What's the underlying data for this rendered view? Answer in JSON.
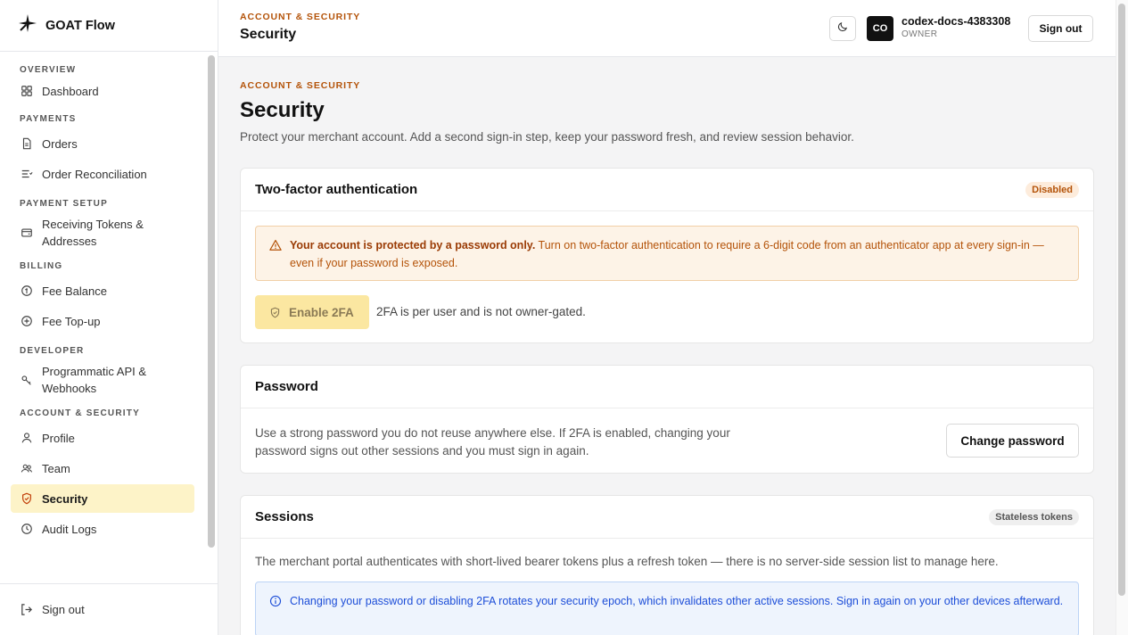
{
  "app": {
    "name": "GOAT Flow"
  },
  "sidebar": {
    "sections": [
      {
        "title": "OVERVIEW",
        "items": [
          {
            "label": "Dashboard",
            "icon": "grid-icon"
          }
        ]
      },
      {
        "title": "PAYMENTS",
        "items": [
          {
            "label": "Orders",
            "icon": "document-icon"
          },
          {
            "label": "Order Reconciliation",
            "icon": "list-check-icon"
          }
        ]
      },
      {
        "title": "PAYMENT SETUP",
        "items": [
          {
            "label": "Receiving Tokens & Addresses",
            "icon": "wallet-icon"
          }
        ]
      },
      {
        "title": "BILLING",
        "items": [
          {
            "label": "Fee Balance",
            "icon": "coin-icon"
          },
          {
            "label": "Fee Top-up",
            "icon": "plus-circle-icon"
          }
        ]
      },
      {
        "title": "DEVELOPER",
        "items": [
          {
            "label": "Programmatic API & Webhooks",
            "icon": "key-icon"
          }
        ]
      },
      {
        "title": "ACCOUNT & SECURITY",
        "items": [
          {
            "label": "Profile",
            "icon": "user-icon"
          },
          {
            "label": "Team",
            "icon": "users-icon"
          },
          {
            "label": "Security",
            "icon": "shield-icon",
            "active": true
          },
          {
            "label": "Audit Logs",
            "icon": "clock-icon"
          }
        ]
      }
    ],
    "footer_signout": "Sign out"
  },
  "header": {
    "eyebrow": "ACCOUNT & SECURITY",
    "title": "Security",
    "avatar_initials": "CO",
    "user_name": "codex-docs-4383308",
    "user_role": "OWNER",
    "signout_label": "Sign out"
  },
  "page": {
    "eyebrow": "ACCOUNT & SECURITY",
    "title": "Security",
    "description": "Protect your merchant account. Add a second sign-in step, keep your password fresh, and review session behavior."
  },
  "two_factor": {
    "title": "Two-factor authentication",
    "status": "Disabled",
    "warning_bold": "Your account is protected by a password only.",
    "warning_text": " Turn on two-factor authentication to require a 6-digit code from an authenticator app at every sign-in — even if your password is exposed.",
    "enable_label": "Enable 2FA",
    "note": "2FA is per user and is not owner-gated."
  },
  "password": {
    "title": "Password",
    "text": "Use a strong password you do not reuse anywhere else. If 2FA is enabled, changing your password signs out other sessions and you must sign in again.",
    "change_label": "Change password"
  },
  "sessions": {
    "title": "Sessions",
    "badge": "Stateless tokens",
    "text": "The merchant portal authenticates with short-lived bearer tokens plus a refresh token — there is no server-side session list to manage here.",
    "info": "Changing your password or disabling 2FA rotates your security epoch, which invalidates other active sessions. Sign in again on your other devices afterward."
  },
  "colors": {
    "accent": "#b45309",
    "active_nav_bg": "#fdf3c8",
    "enable_button_bg": "#fbe7a1",
    "info_blue": "#1d4ed8"
  }
}
